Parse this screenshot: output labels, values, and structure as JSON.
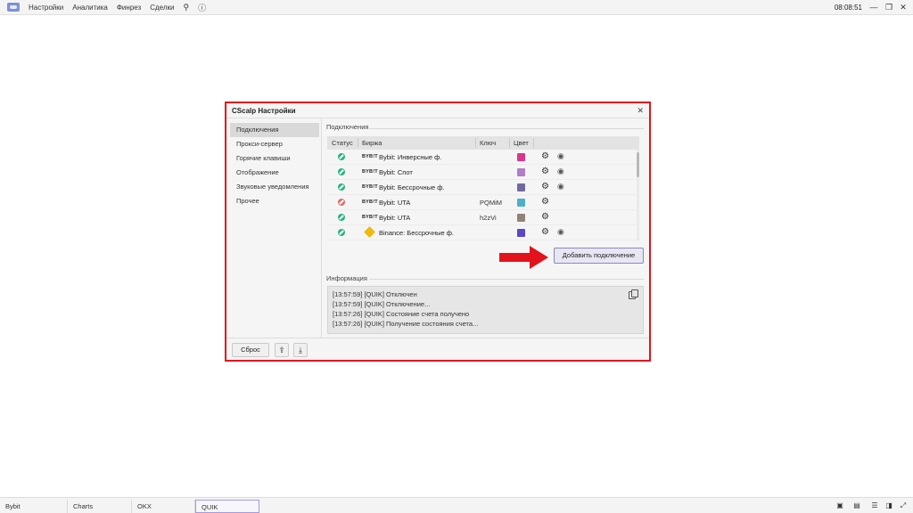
{
  "topbar": {
    "menu": [
      "Настройки",
      "Аналитика",
      "Финрез",
      "Сделки"
    ],
    "clock": "08:08:51",
    "icons": [
      "cscalp-logo",
      "pin-off-icon",
      "help-icon",
      "minimize-icon",
      "restore-icon",
      "close-icon"
    ]
  },
  "dialog": {
    "title": "CScalp Настройки",
    "sidebar": [
      "Подключения",
      "Прокси-сервер",
      "Горячие клавиши",
      "Отображение",
      "Звуковые уведомления",
      "Прочее"
    ],
    "active_sidebar": "Подключения",
    "connections_title": "Подключения",
    "columns": {
      "status": "Статус",
      "exchange": "Биржа",
      "key": "Ключ",
      "color": "Цвет"
    },
    "rows": [
      {
        "status": "connected",
        "logo": "BYB!T",
        "name": "Bybit: Инверсные ф.",
        "key": "",
        "color": "#d8368a",
        "eye": true
      },
      {
        "status": "connected",
        "logo": "BYB!T",
        "name": "Bybit: Спот",
        "key": "",
        "color": "#b07ccc",
        "eye": true
      },
      {
        "status": "connected",
        "logo": "BYB!T",
        "name": "Bybit: Бессрочные ф.",
        "key": "",
        "color": "#726a9f",
        "eye": true
      },
      {
        "status": "error",
        "logo": "BYB!T",
        "name": "Bybit: UTA",
        "key": "PQMiM",
        "color": "#4db0c8",
        "eye": false
      },
      {
        "status": "connected",
        "logo": "BYB!T",
        "name": "Bybit: UTA",
        "key": "h2zVi",
        "color": "#938275",
        "eye": false
      },
      {
        "status": "connected",
        "logo": "binance",
        "name": "Binance: Бессрочные ф.",
        "key": "",
        "color": "#5b46c4",
        "eye": true
      }
    ],
    "add_button": "Добавить подключение",
    "info_title": "Информация",
    "log": [
      "[13:57:59] [QUIK] Отключен",
      "[13:57:59] [QUIK] Отключение...",
      "[13:57:26] [QUIK] Состояние счета получено",
      "[13:57:26] [QUIK] Получение состояния счета..."
    ],
    "reset_button": "Сброс",
    "highlight_color": "#e3131e"
  },
  "bottombar": {
    "tabs": [
      "Bybit",
      "Charts",
      "OKX",
      "QUIK"
    ],
    "active_tab": "QUIK"
  }
}
